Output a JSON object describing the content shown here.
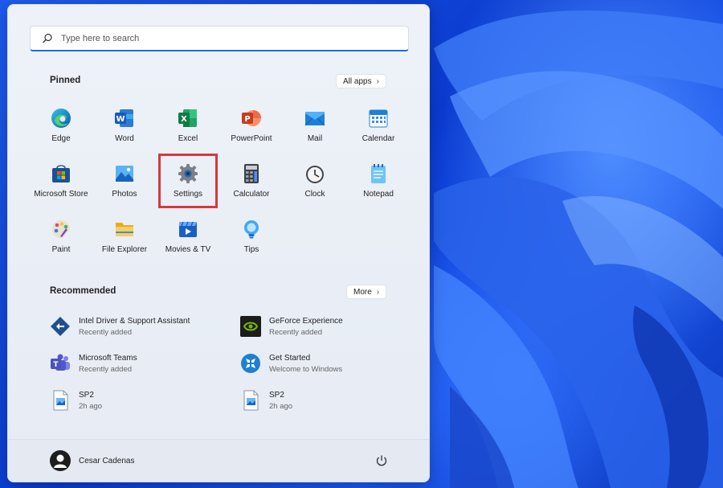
{
  "search": {
    "placeholder": "Type here to search"
  },
  "pinned": {
    "title": "Pinned",
    "all_apps_label": "All apps",
    "apps": [
      {
        "label": "Edge",
        "icon": "edge-icon"
      },
      {
        "label": "Word",
        "icon": "word-icon"
      },
      {
        "label": "Excel",
        "icon": "excel-icon"
      },
      {
        "label": "PowerPoint",
        "icon": "powerpoint-icon"
      },
      {
        "label": "Mail",
        "icon": "mail-icon"
      },
      {
        "label": "Calendar",
        "icon": "calendar-icon"
      },
      {
        "label": "Microsoft Store",
        "icon": "store-icon"
      },
      {
        "label": "Photos",
        "icon": "photos-icon"
      },
      {
        "label": "Settings",
        "icon": "settings-gear-icon"
      },
      {
        "label": "Calculator",
        "icon": "calculator-icon"
      },
      {
        "label": "Clock",
        "icon": "clock-icon"
      },
      {
        "label": "Notepad",
        "icon": "notepad-icon"
      },
      {
        "label": "Paint",
        "icon": "paint-icon"
      },
      {
        "label": "File Explorer",
        "icon": "folder-icon"
      },
      {
        "label": "Movies & TV",
        "icon": "movies-icon"
      },
      {
        "label": "Tips",
        "icon": "tips-bulb-icon"
      }
    ]
  },
  "recommended": {
    "title": "Recommended",
    "more_label": "More",
    "items": [
      {
        "title": "Intel Driver & Support Assistant",
        "subtitle": "Recently added",
        "icon": "intel-dsa-icon"
      },
      {
        "title": "GeForce Experience",
        "subtitle": "Recently added",
        "icon": "nvidia-icon"
      },
      {
        "title": "Microsoft Teams",
        "subtitle": "Recently added",
        "icon": "teams-icon"
      },
      {
        "title": "Get Started",
        "subtitle": "Welcome to Windows",
        "icon": "get-started-icon"
      },
      {
        "title": "SP2",
        "subtitle": "2h ago",
        "icon": "image-file-icon"
      },
      {
        "title": "SP2",
        "subtitle": "2h ago",
        "icon": "image-file-icon"
      }
    ]
  },
  "user": {
    "name": "Cesar Cadenas"
  },
  "colors": {
    "accent": "#1a6fd6",
    "highlight": "#d9373d",
    "wallpaper": "#0b3bcf"
  }
}
